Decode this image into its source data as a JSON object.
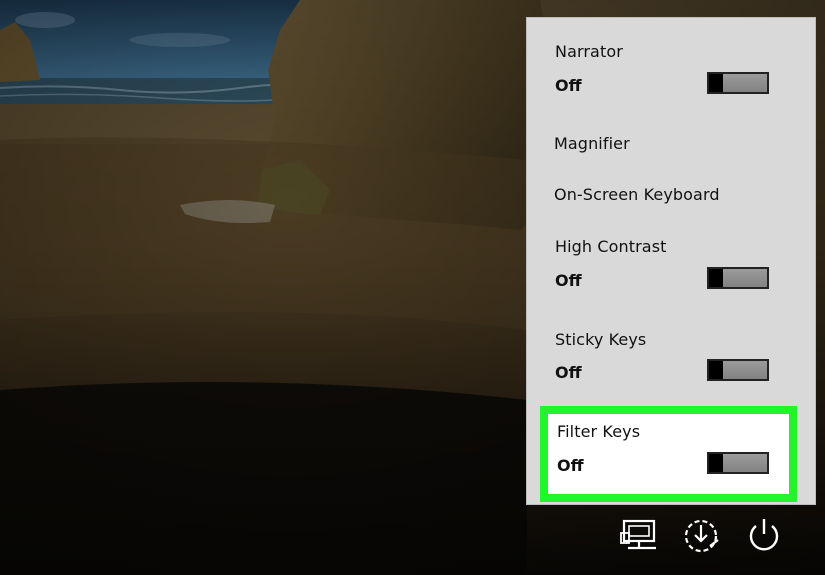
{
  "background": {
    "description_icon": "beach-rock-wallpaper"
  },
  "accessibility_menu": {
    "items": [
      {
        "label": "Narrator",
        "state": "Off",
        "has_toggle": true
      },
      {
        "label": "Magnifier",
        "has_toggle": false
      },
      {
        "label": "On-Screen Keyboard",
        "has_toggle": false
      },
      {
        "label": "High Contrast",
        "state": "Off",
        "has_toggle": true
      },
      {
        "label": "Sticky Keys",
        "state": "Off",
        "has_toggle": true
      },
      {
        "label": "Filter Keys",
        "state": "Off",
        "has_toggle": true,
        "highlighted": true
      }
    ],
    "highlight_color": "#22f52a"
  },
  "bottom_icons": [
    {
      "name": "network-icon"
    },
    {
      "name": "ease-of-access-icon"
    },
    {
      "name": "power-icon"
    }
  ]
}
